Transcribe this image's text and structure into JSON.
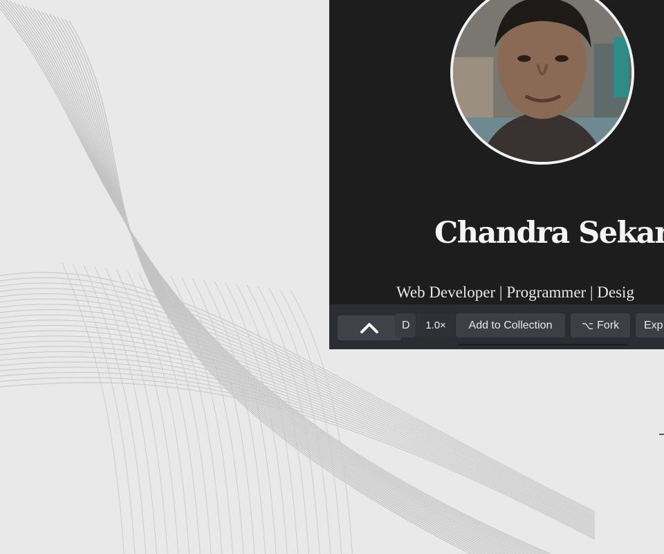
{
  "profile": {
    "name": "Chandra Sekar",
    "tagline": "Web Developer | Programmer | Desig"
  },
  "toolbar": {
    "up_icon": "chevron-up-icon",
    "partial_label": "D",
    "speed": "1.0×",
    "add_to_collection": "Add to Collection",
    "fork_icon": "fork-icon",
    "fork_glyph": "⌥",
    "fork": "Fork",
    "export_partial": "Exp"
  },
  "colors": {
    "background": "#e9e9e9",
    "preview_bg": "#1d1d1d",
    "toolbar_bg": "#2b2d33",
    "button_bg": "#3c3f46",
    "text_light": "#f4f4f4"
  }
}
